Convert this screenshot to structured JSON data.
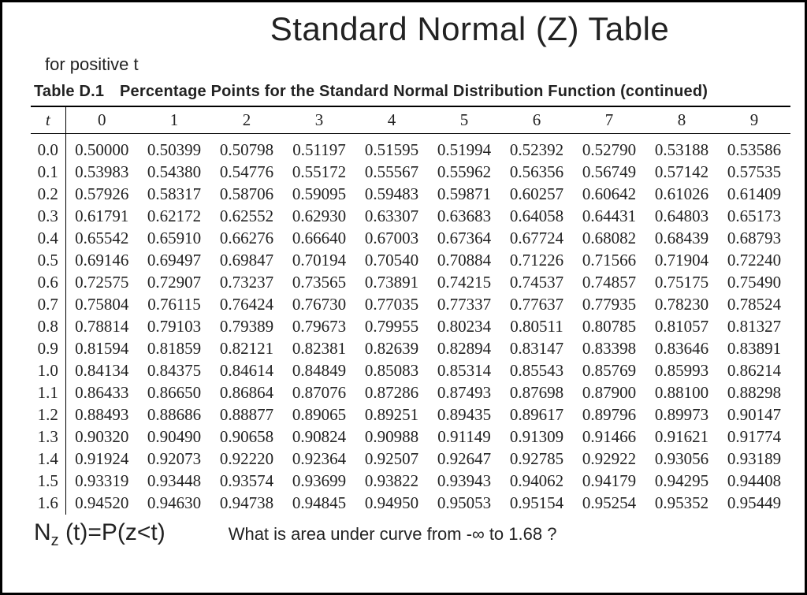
{
  "chart_data": {
    "type": "table",
    "title": "Standard Normal (Z) Table",
    "subtitle": "for positive t",
    "caption_number": "Table D.1",
    "caption_text": "Percentage Points for the Standard Normal Distribution Function (continued)",
    "row_header_label": "t",
    "col_headers": [
      "0",
      "1",
      "2",
      "3",
      "4",
      "5",
      "6",
      "7",
      "8",
      "9"
    ],
    "row_headers": [
      "0.0",
      "0.1",
      "0.2",
      "0.3",
      "0.4",
      "0.5",
      "0.6",
      "0.7",
      "0.8",
      "0.9",
      "1.0",
      "1.1",
      "1.2",
      "1.3",
      "1.4",
      "1.5",
      "1.6"
    ],
    "rows": [
      [
        "0.50000",
        "0.50399",
        "0.50798",
        "0.51197",
        "0.51595",
        "0.51994",
        "0.52392",
        "0.52790",
        "0.53188",
        "0.53586"
      ],
      [
        "0.53983",
        "0.54380",
        "0.54776",
        "0.55172",
        "0.55567",
        "0.55962",
        "0.56356",
        "0.56749",
        "0.57142",
        "0.57535"
      ],
      [
        "0.57926",
        "0.58317",
        "0.58706",
        "0.59095",
        "0.59483",
        "0.59871",
        "0.60257",
        "0.60642",
        "0.61026",
        "0.61409"
      ],
      [
        "0.61791",
        "0.62172",
        "0.62552",
        "0.62930",
        "0.63307",
        "0.63683",
        "0.64058",
        "0.64431",
        "0.64803",
        "0.65173"
      ],
      [
        "0.65542",
        "0.65910",
        "0.66276",
        "0.66640",
        "0.67003",
        "0.67364",
        "0.67724",
        "0.68082",
        "0.68439",
        "0.68793"
      ],
      [
        "0.69146",
        "0.69497",
        "0.69847",
        "0.70194",
        "0.70540",
        "0.70884",
        "0.71226",
        "0.71566",
        "0.71904",
        "0.72240"
      ],
      [
        "0.72575",
        "0.72907",
        "0.73237",
        "0.73565",
        "0.73891",
        "0.74215",
        "0.74537",
        "0.74857",
        "0.75175",
        "0.75490"
      ],
      [
        "0.75804",
        "0.76115",
        "0.76424",
        "0.76730",
        "0.77035",
        "0.77337",
        "0.77637",
        "0.77935",
        "0.78230",
        "0.78524"
      ],
      [
        "0.78814",
        "0.79103",
        "0.79389",
        "0.79673",
        "0.79955",
        "0.80234",
        "0.80511",
        "0.80785",
        "0.81057",
        "0.81327"
      ],
      [
        "0.81594",
        "0.81859",
        "0.82121",
        "0.82381",
        "0.82639",
        "0.82894",
        "0.83147",
        "0.83398",
        "0.83646",
        "0.83891"
      ],
      [
        "0.84134",
        "0.84375",
        "0.84614",
        "0.84849",
        "0.85083",
        "0.85314",
        "0.85543",
        "0.85769",
        "0.85993",
        "0.86214"
      ],
      [
        "0.86433",
        "0.86650",
        "0.86864",
        "0.87076",
        "0.87286",
        "0.87493",
        "0.87698",
        "0.87900",
        "0.88100",
        "0.88298"
      ],
      [
        "0.88493",
        "0.88686",
        "0.88877",
        "0.89065",
        "0.89251",
        "0.89435",
        "0.89617",
        "0.89796",
        "0.89973",
        "0.90147"
      ],
      [
        "0.90320",
        "0.90490",
        "0.90658",
        "0.90824",
        "0.90988",
        "0.91149",
        "0.91309",
        "0.91466",
        "0.91621",
        "0.91774"
      ],
      [
        "0.91924",
        "0.92073",
        "0.92220",
        "0.92364",
        "0.92507",
        "0.92647",
        "0.92785",
        "0.92922",
        "0.93056",
        "0.93189"
      ],
      [
        "0.93319",
        "0.93448",
        "0.93574",
        "0.93699",
        "0.93822",
        "0.93943",
        "0.94062",
        "0.94179",
        "0.94295",
        "0.94408"
      ],
      [
        "0.94520",
        "0.94630",
        "0.94738",
        "0.94845",
        "0.94950",
        "0.95053",
        "0.95154",
        "0.95254",
        "0.95352",
        "0.95449"
      ]
    ]
  },
  "footer": {
    "formula_html": "N<sub>z</sub> (t)=P(z&lt;t)",
    "question": "What is area under curve from -∞ to 1.68 ?"
  }
}
